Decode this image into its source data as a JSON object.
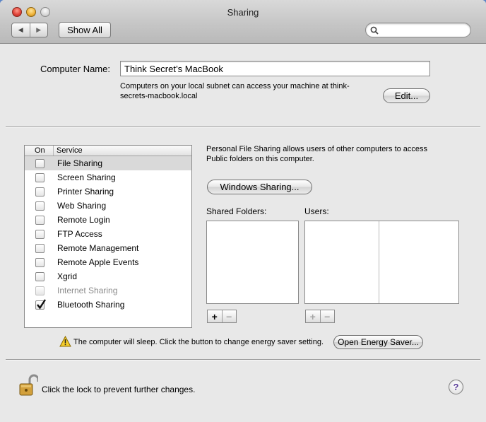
{
  "window": {
    "title": "Sharing"
  },
  "toolbar": {
    "back_icon": "back-arrow-icon",
    "forward_icon": "forward-arrow-icon",
    "show_all_label": "Show All",
    "search_placeholder": ""
  },
  "computer_name": {
    "label": "Computer Name:",
    "value": "Think Secret’s MacBook",
    "description_line1": "Computers on your local subnet can access your machine at think-",
    "description_line2": "secrets-macbook.local",
    "edit_label": "Edit..."
  },
  "services": {
    "header_on": "On",
    "header_service": "Service",
    "items": [
      {
        "name": "File Sharing",
        "checked": false,
        "selected": true,
        "enabled": true
      },
      {
        "name": "Screen Sharing",
        "checked": false,
        "selected": false,
        "enabled": true
      },
      {
        "name": "Printer Sharing",
        "checked": false,
        "selected": false,
        "enabled": true
      },
      {
        "name": "Web Sharing",
        "checked": false,
        "selected": false,
        "enabled": true
      },
      {
        "name": "Remote Login",
        "checked": false,
        "selected": false,
        "enabled": true
      },
      {
        "name": "FTP Access",
        "checked": false,
        "selected": false,
        "enabled": true
      },
      {
        "name": "Remote Management",
        "checked": false,
        "selected": false,
        "enabled": true
      },
      {
        "name": "Remote Apple Events",
        "checked": false,
        "selected": false,
        "enabled": true
      },
      {
        "name": "Xgrid",
        "checked": false,
        "selected": false,
        "enabled": true
      },
      {
        "name": "Internet Sharing",
        "checked": false,
        "selected": false,
        "enabled": false
      },
      {
        "name": "Bluetooth Sharing",
        "checked": true,
        "selected": false,
        "enabled": true
      }
    ]
  },
  "detail": {
    "description_line1": "Personal File Sharing allows users of other computers to access",
    "description_line2": "Public folders on this computer.",
    "windows_sharing_label": "Windows Sharing...",
    "shared_folders_label": "Shared Folders:",
    "users_label": "Users:",
    "plus": "+",
    "minus": "−"
  },
  "energy": {
    "warning_icon": "warning-icon",
    "message": "The computer will sleep. Click the button to change energy saver setting.",
    "button_label": "Open Energy Saver..."
  },
  "footer": {
    "lock_icon": "unlocked-padlock-icon",
    "lock_text": "Click the lock to prevent further changes.",
    "help_label": "?"
  },
  "colors": {
    "selection": "#d9d9d9",
    "desktop": "#4a76bf"
  }
}
